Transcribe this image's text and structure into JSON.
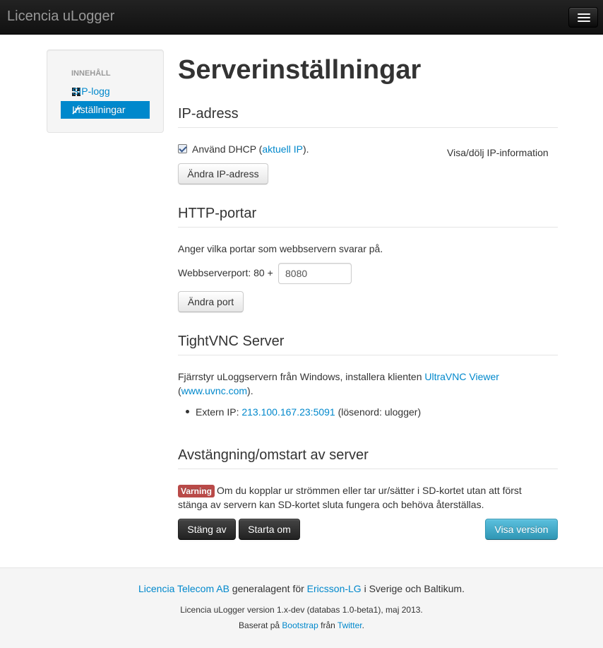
{
  "navbar": {
    "brand": "Licencia uLogger",
    "menu_icon": "hamburger-icon"
  },
  "sidebar": {
    "header": "INNEHÅLL",
    "items": [
      {
        "label": "SIP-logg",
        "icon": "grid-icon",
        "active": false
      },
      {
        "label": "Inställningar",
        "icon": "wrench-icon",
        "active": true
      }
    ]
  },
  "page": {
    "title": "Serverinställningar"
  },
  "ip_section": {
    "heading": "IP-adress",
    "checkbox_checked": true,
    "dhcp_text": "Använd DHCP (",
    "current_ip_link": "aktuell IP",
    "dhcp_suffix": ").",
    "toggle_link": "Visa/dölj IP-information",
    "change_button": "Ändra IP-adress"
  },
  "http_section": {
    "heading": "HTTP-portar",
    "description": "Anger vilka portar som webbservern svarar på.",
    "port_label": "Webbserverport: 80 +",
    "port_value": "8080",
    "change_button": "Ändra port"
  },
  "vnc_section": {
    "heading": "TightVNC Server",
    "text_before": "Fjärrstyr uLoggservern från Windows, installera klienten ",
    "viewer_link": "UltraVNC Viewer",
    "open_paren": "(",
    "site_link": "www.uvnc.com",
    "close_paren": ").",
    "extern_label": "Extern IP: ",
    "extern_ip": "213.100.167.23:5091",
    "password_note": " (lösenord: ulogger)"
  },
  "shutdown_section": {
    "heading": "Avstängning/omstart av server",
    "warning_badge": "Varning",
    "warning_line1": "Om du kopplar ur strömmen eller tar ur/sätter i SD-kortet utan att först",
    "warning_line2": "stänga av servern kan SD-kortet sluta fungera och behöva återställas.",
    "shutdown_button": "Stäng av",
    "restart_button": "Starta om",
    "version_button": "Visa version"
  },
  "footer": {
    "company_link": "Licencia Telecom AB",
    "agent_text": " generalagent för ",
    "ericsson_link": "Ericsson-LG",
    "region_text": " i Sverige och Baltikum.",
    "version_text": "Licencia uLogger version 1.x-dev (databas 1.0-beta1), maj 2013.",
    "based_text": "Baserat på ",
    "bootstrap_link": "Bootstrap",
    "from_text": " från ",
    "twitter_link": "Twitter",
    "end_text": "."
  },
  "colors": {
    "link": "#0088cc",
    "navbar": "#1b1b1b",
    "danger": "#b94a48",
    "info": "#49afcd"
  }
}
